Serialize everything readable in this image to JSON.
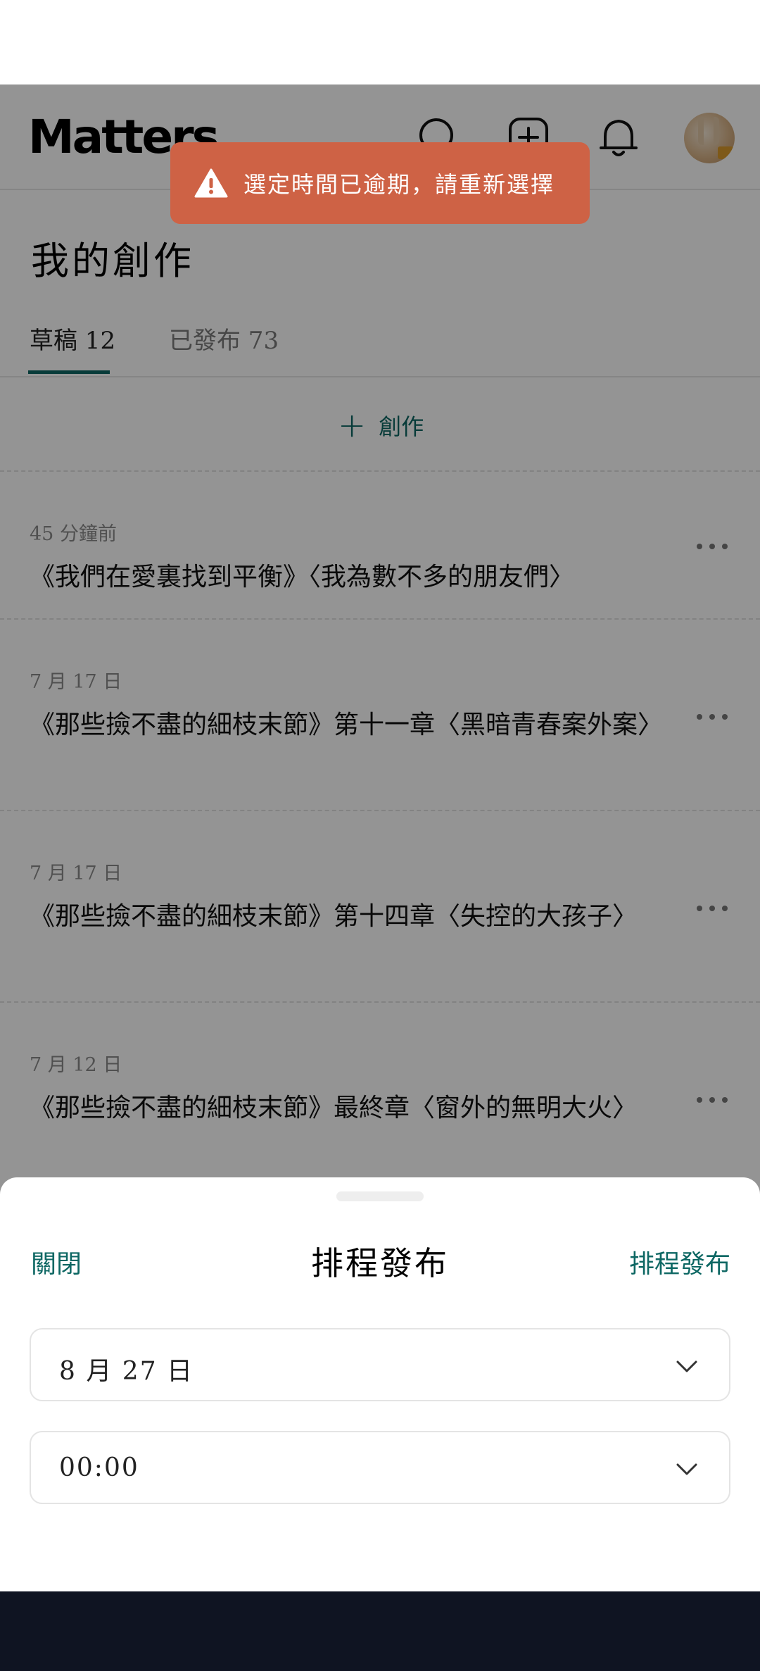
{
  "app": {
    "logo": "Matters",
    "header_icons": [
      "search-icon",
      "create-icon",
      "bell-icon"
    ]
  },
  "page": {
    "title": "我的創作"
  },
  "tabs": [
    {
      "label": "草稿 12",
      "active": true
    },
    {
      "label": "已發布 73",
      "active": false
    }
  ],
  "create_label": "創作",
  "drafts": [
    {
      "date": "45 分鐘前",
      "title": "《我們在愛裏找到平衡》〈我為數不多的朋友們〉"
    },
    {
      "date": "7 月 17 日",
      "title": "《那些撿不盡的細枝末節》第十一章〈黑暗青春案外案〉"
    },
    {
      "date": "7 月 17 日",
      "title": "《那些撿不盡的細枝末節》第十四章〈失控的大孩子〉"
    },
    {
      "date": "7 月 12 日",
      "title": "《那些撿不盡的細枝末節》最終章〈窗外的無明大火〉"
    }
  ],
  "toast": {
    "message": "選定時間已逾期，請重新選擇",
    "icon": "warning-icon",
    "color": "#ce6245"
  },
  "sheet": {
    "close_label": "關閉",
    "title": "排程發布",
    "submit_label": "排程發布",
    "date_value": "8 月 27 日",
    "time_value": "00:00"
  },
  "colors": {
    "accent": "#0d6763",
    "overlay": "rgba(0,0,0,0.42)",
    "navbar": "#0f1422"
  }
}
